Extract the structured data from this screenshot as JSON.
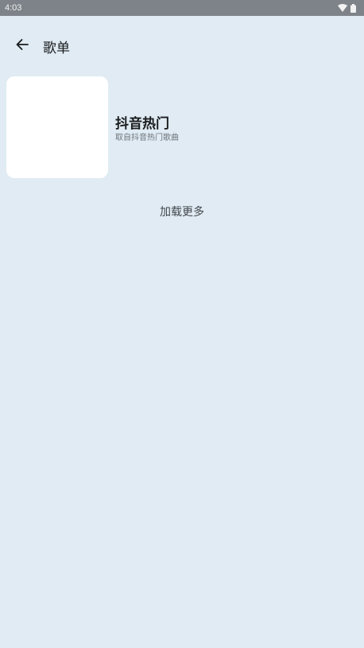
{
  "status_bar": {
    "time": "4:03",
    "icons": [
      "wifi-icon",
      "battery-icon"
    ]
  },
  "app_bar": {
    "back_icon": "arrow-left-icon",
    "title": "歌单"
  },
  "playlists": [
    {
      "title": "抖音热门",
      "subtitle": "取自抖音热门歌曲"
    }
  ],
  "load_more": "加载更多",
  "colors": {
    "background": "#e0ebf3",
    "status_bar": "#7d8388",
    "cover": "#ffffff",
    "text_primary": "#1a1c1e",
    "text_secondary": "#6f757b"
  }
}
